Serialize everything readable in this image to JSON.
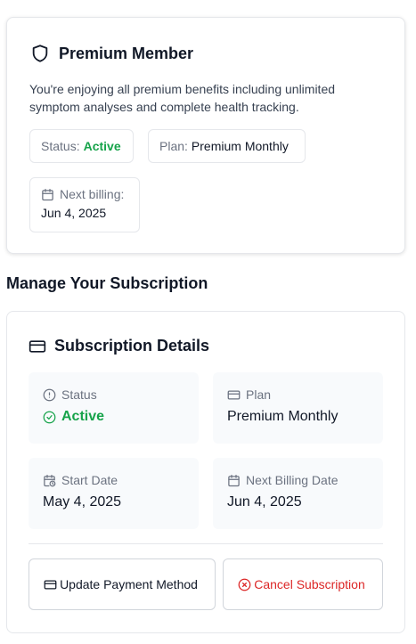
{
  "premium": {
    "title": "Premium Member",
    "description": "You're enjoying all premium benefits including unlimited symptom analyses and complete health tracking.",
    "status_label": "Status:",
    "status_value": "Active",
    "plan_label": "Plan:",
    "plan_value": "Premium Monthly",
    "billing_label": "Next billing:",
    "billing_value": "Jun 4, 2025"
  },
  "manage": {
    "heading": "Manage Your Subscription"
  },
  "details": {
    "title": "Subscription Details",
    "status_label": "Status",
    "status_value": "Active",
    "plan_label": "Plan",
    "plan_value": "Premium Monthly",
    "start_label": "Start Date",
    "start_value": "May 4, 2025",
    "next_label": "Next Billing Date",
    "next_value": "Jun 4, 2025"
  },
  "actions": {
    "update_payment": "Update Payment Method",
    "cancel": "Cancel Subscription"
  },
  "colors": {
    "accent_green": "#16a34a",
    "danger_red": "#dc2626"
  },
  "icons": [
    "shield-icon",
    "calendar-icon",
    "credit-card-icon",
    "alert-circle-icon",
    "check-circle-icon",
    "calendar-clock-icon",
    "x-circle-icon"
  ]
}
